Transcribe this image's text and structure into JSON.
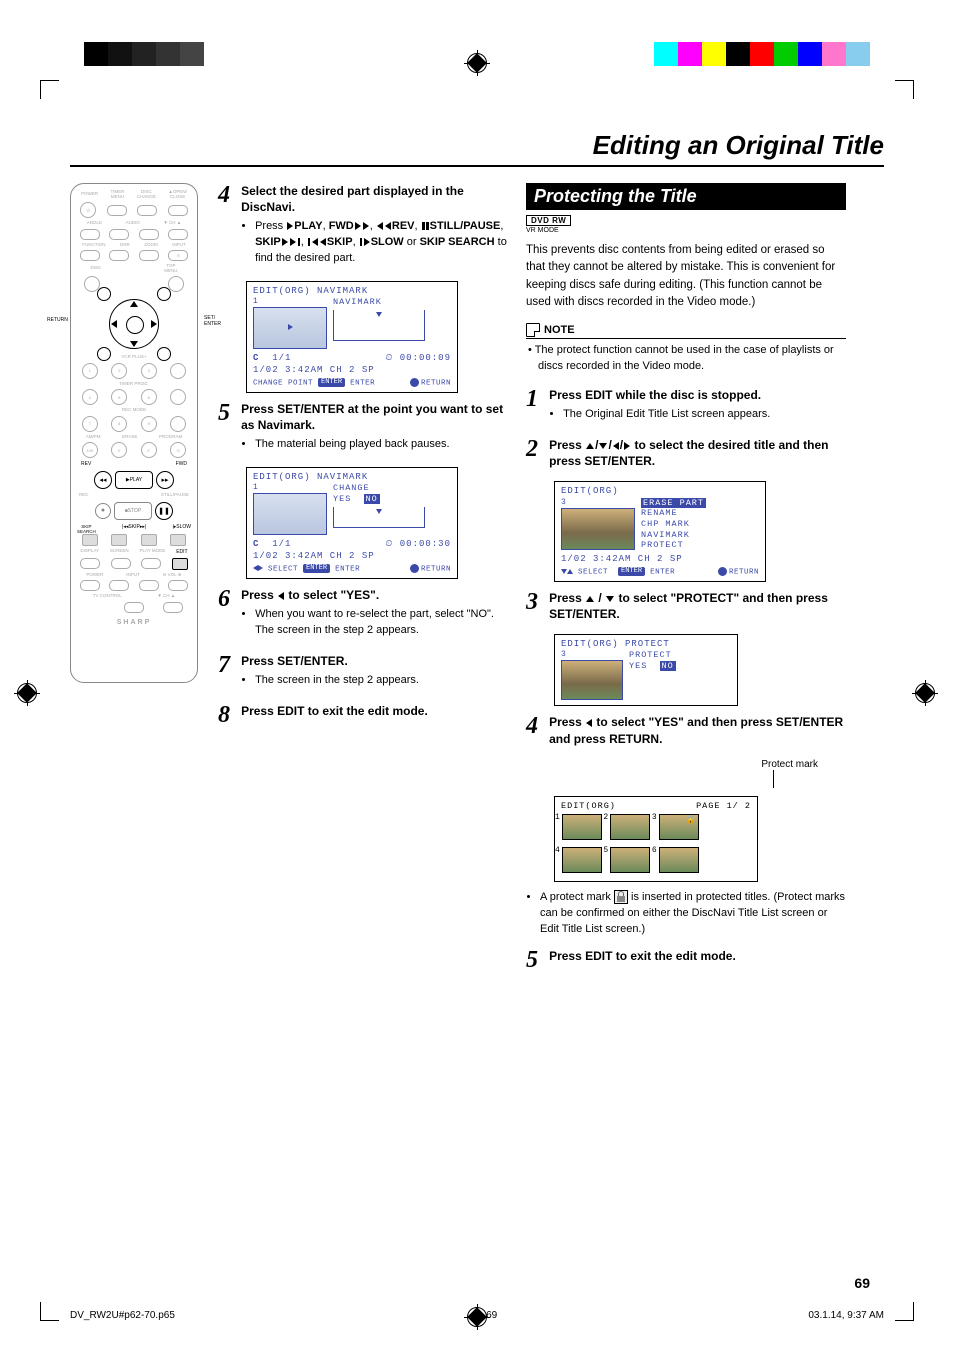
{
  "page": {
    "title": "Editing an Original Title",
    "section_title": "Protecting the Title",
    "page_number": "69",
    "footer_file": "DV_RW2U#p62-70.p65",
    "footer_page": "69",
    "footer_date": "03.1.14, 9:37 AM",
    "mode_tag": "DVD RW",
    "mode_sub": "VR MODE",
    "intro": "This prevents disc contents from being edited or erased so that they cannot be altered by mistake. This is convenient for keeping discs safe during editing. (This function cannot be used with discs recorded in the Video mode.)",
    "note_label": "NOTE",
    "note_body": "•  The protect function cannot be used in the case of playlists or discs recorded in the Video mode.",
    "protect_mark_label": "Protect mark",
    "protect_mark_desc_1": "A protect mark ",
    "protect_mark_desc_2": " is inserted in protected titles. (Protect marks can be confirmed on either the DiscNavi Title List screen or Edit Title List screen.)"
  },
  "mid_steps": {
    "s4": {
      "num": "4",
      "head": "Select the desired part displayed in the DiscNavi.",
      "bullet_pre": "Press ",
      "play": "PLAY",
      "fwd": "FWD",
      "rev": "REV",
      "still": "STILL/PAUSE",
      "skip_f": "SKIP",
      "skip_b": "SKIP",
      "slow": "SLOW",
      "or": " or ",
      "ss": "SKIP SEARCH",
      "tail": "to find the desired part."
    },
    "s5": {
      "num": "5",
      "head_a": "Press ",
      "head_b": "SET/ENTER",
      "head_c": " at the point you want to set as Navimark.",
      "bullet": "The material being played back pauses."
    },
    "s6": {
      "num": "6",
      "head_a": "Press ",
      "head_b": " to select \"YES\".",
      "bullet": "When you want to re-select the part, select \"NO\". The screen in the step 2 appears."
    },
    "s7": {
      "num": "7",
      "head_a": "Press ",
      "head_b": "SET/ENTER",
      "head_c": ".",
      "bullet": "The screen in the step 2 appears."
    },
    "s8": {
      "num": "8",
      "head_a": "Press ",
      "head_b": "EDIT",
      "head_c": " to exit the edit mode."
    }
  },
  "right_steps": {
    "s1": {
      "num": "1",
      "head_a": "Press ",
      "head_b": "EDIT",
      "head_c": " while the disc is stopped.",
      "bullet": "The Original Edit Title List screen appears."
    },
    "s2": {
      "num": "2",
      "head_a": "Press ",
      "head_b": " to select the desired title and then press ",
      "head_c": "SET/ENTER",
      "head_d": "."
    },
    "s3": {
      "num": "3",
      "head_a": "Press ",
      "head_b": " to select \"PROTECT\" and then press ",
      "head_c": "SET/ENTER",
      "head_d": "."
    },
    "s4": {
      "num": "4",
      "head_a": "Press ",
      "head_b": " to select \"YES\" and then press ",
      "head_c": "SET/ENTER",
      "head_d": " and press ",
      "head_e": "RETURN",
      "head_f": "."
    },
    "s5": {
      "num": "5",
      "head_a": "Press ",
      "head_b": "EDIT",
      "head_c": " to exit the edit mode."
    }
  },
  "osd1": {
    "title": "EDIT(ORG) NAVIMARK",
    "thumb_no": "1",
    "side1": "NAVIMARK",
    "c": "C",
    "frac": "1/1",
    "clock_icon": "⏱",
    "time": "00:00:09",
    "info": "1/02  3:42AM  CH   2  SP",
    "foot_l": "CHANGE POINT",
    "foot_m": "ENTER",
    "foot_r": "RETURN",
    "enter_pill": "ENTER"
  },
  "osd2": {
    "title": "EDIT(ORG) NAVIMARK",
    "thumb_no": "1",
    "side1": "CHANGE",
    "side2": "YES",
    "side2b": "NO",
    "c": "C",
    "frac": "1/1",
    "time": "00:00:30",
    "info": "1/02  3:42AM  CH   2  SP",
    "foot_l": "SELECT",
    "foot_m": "ENTER",
    "foot_r": "RETURN",
    "enter_pill": "ENTER"
  },
  "osd3": {
    "title": "EDIT(ORG)",
    "thumb_no": "3",
    "m1": "ERASE PART",
    "m2": "RENAME",
    "m3": "CHP MARK",
    "m4": "NAVIMARK",
    "m5": "PROTECT",
    "info": "1/02   3:42AM  CH   2  SP",
    "foot_l": "SELECT",
    "foot_m": "ENTER",
    "foot_r": "RETURN",
    "enter_pill": "ENTER"
  },
  "osd4": {
    "title": "EDIT(ORG) PROTECT",
    "thumb_no": "3",
    "side1": "PROTECT",
    "side2": "YES",
    "side2b": "NO"
  },
  "osd5": {
    "title": "EDIT(ORG)",
    "page": "PAGE 1/ 2"
  },
  "remote": {
    "return": "RETURN",
    "set_enter": "SET/\nENTER",
    "rev": "REV",
    "fwd": "FWD",
    "play": "PLAY",
    "stop": "STOP",
    "still": "STILL/PAUSE",
    "skip_search": "SKIP\nSEARCH",
    "skip": "SKIP",
    "slow": "SLOW",
    "edit": "EDIT",
    "tv": "TV CONTROL",
    "brand": "SHARP"
  }
}
